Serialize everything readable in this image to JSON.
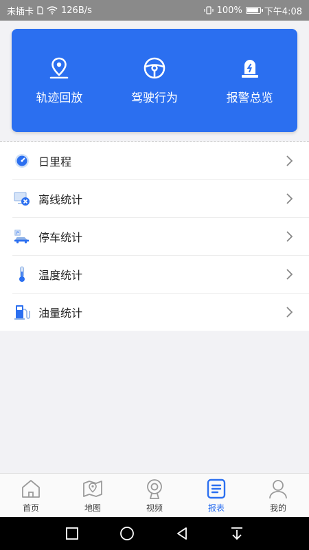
{
  "status_bar": {
    "carrier": "未插卡",
    "speed": "126B/s",
    "battery": "100%",
    "time": "下午4:08"
  },
  "quick_actions": [
    {
      "label": "轨迹回放",
      "icon": "location-pin-icon"
    },
    {
      "label": "驾驶行为",
      "icon": "steering-wheel-icon"
    },
    {
      "label": "报警总览",
      "icon": "alarm-light-icon"
    }
  ],
  "report_list": [
    {
      "label": "日里程",
      "icon": "odometer-icon"
    },
    {
      "label": "离线统计",
      "icon": "offline-monitor-icon"
    },
    {
      "label": "停车统计",
      "icon": "parking-car-icon"
    },
    {
      "label": "温度统计",
      "icon": "thermometer-icon"
    },
    {
      "label": "油量统计",
      "icon": "fuel-pump-icon"
    }
  ],
  "bottom_nav": [
    {
      "label": "首页",
      "icon": "home-icon"
    },
    {
      "label": "地图",
      "icon": "map-icon"
    },
    {
      "label": "视频",
      "icon": "camera-icon"
    },
    {
      "label": "报表",
      "icon": "report-icon",
      "active": true
    },
    {
      "label": "我的",
      "icon": "user-icon"
    }
  ],
  "colors": {
    "accent": "#2b6ff0",
    "inactive_icon": "#9a9a9a"
  }
}
